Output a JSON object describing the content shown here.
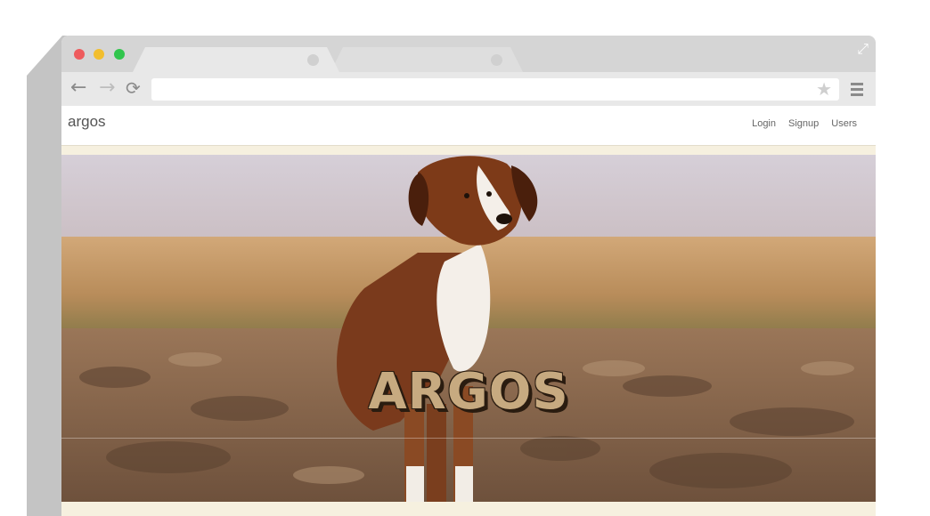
{
  "site": {
    "brand": "argos",
    "nav": [
      "Login",
      "Signup",
      "Users"
    ],
    "hero_title": "ARGOS"
  },
  "icons": {
    "back": "arrow-left-icon",
    "forward": "arrow-right-icon",
    "reload": "reload-icon",
    "bookmark": "star-icon",
    "menu": "hamburger-menu-icon",
    "fullscreen": "expand-icon"
  },
  "colors": {
    "close": "#ee5b5d",
    "minimize": "#f2be2d",
    "maximize": "#31c54c",
    "hero_title": "#c7aa80"
  }
}
